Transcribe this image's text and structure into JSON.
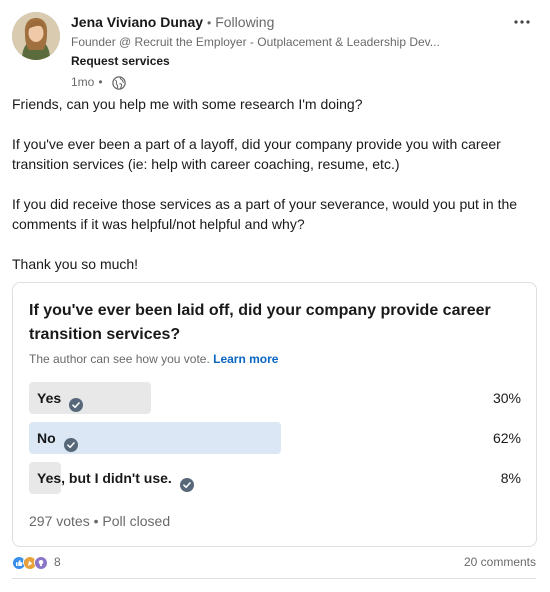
{
  "author": {
    "name": "Jena Viviano Dunay",
    "separator": "•",
    "follow_status": "Following",
    "headline": "Founder @ Recruit the Employer - Outplacement & Leadership Dev...",
    "request_services": "Request services",
    "time_ago": "1mo",
    "time_separator": "•",
    "visibility_icon": "globe-icon",
    "more_icon": "more-horizontal-icon"
  },
  "post": {
    "paragraphs": [
      "Friends, can you help me with some research I'm doing?",
      "If you've ever been a part of a layoff, did your company provide you with career transition services (ie: help with career coaching, resume, etc.)",
      "If you did receive those services as a part of your severance, would you put in the comments if it was helpful/not helpful and why?",
      "Thank you so much!"
    ]
  },
  "poll": {
    "question": "If you've ever been laid off, did your company provide career transition services?",
    "note": "The author can see how you vote.",
    "learn_more": "Learn more",
    "options": [
      {
        "label": "Yes",
        "percent": "30%",
        "fraction": 0.3,
        "selected": false,
        "check_icon": "check-circle-icon"
      },
      {
        "label": "No",
        "percent": "62%",
        "fraction": 0.62,
        "selected": true,
        "check_icon": "check-circle-icon"
      },
      {
        "label": "Yes, but I didn't use.",
        "percent": "8%",
        "fraction": 0.08,
        "selected": false,
        "check_icon": "check-circle-icon"
      }
    ],
    "votes": "297 votes",
    "footer_separator": "•",
    "status": "Poll closed"
  },
  "social": {
    "reaction_icons": [
      "like-icon",
      "celebrate-icon",
      "insightful-icon"
    ],
    "reaction_count": "8",
    "comments": "20 comments"
  },
  "colors": {
    "accent": "#0a66c2",
    "bar_default": "#e8e8e8",
    "bar_selected": "#dbe7f5",
    "check_gray": "#56687a"
  }
}
